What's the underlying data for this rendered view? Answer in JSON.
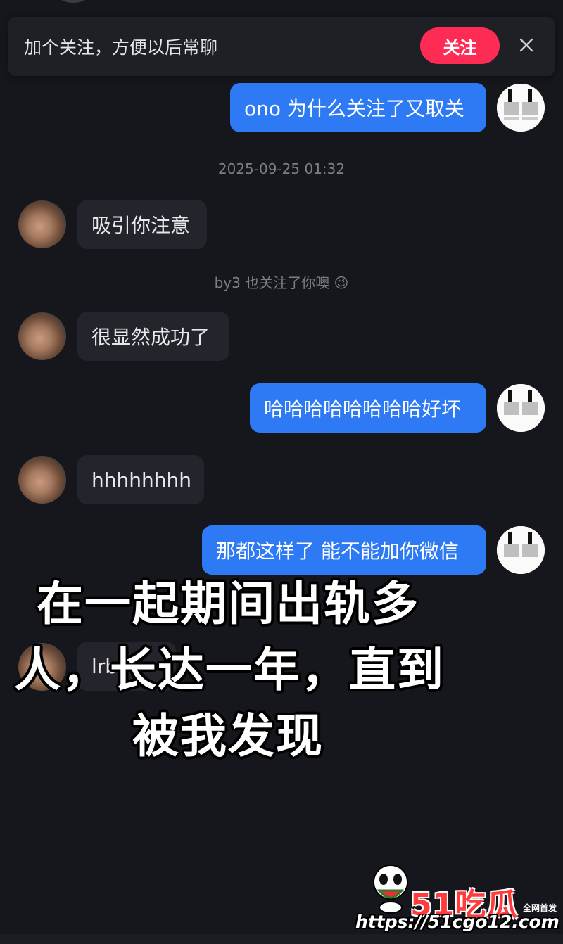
{
  "follow_banner": {
    "text": "加个关注，方便以后常聊",
    "follow_label": "关注"
  },
  "messages": [
    {
      "side": "sent",
      "text": "ono 为什么关注了又取关"
    },
    {
      "side": "received",
      "text": "吸引你注意"
    },
    {
      "side": "received",
      "text": "很显然成功了"
    },
    {
      "side": "sent",
      "text": "哈哈哈哈哈哈哈哈好坏"
    },
    {
      "side": "received",
      "text": "hhhhhhhh"
    },
    {
      "side": "sent",
      "text": "那都这样了 能不能加你微信"
    },
    {
      "side": "received",
      "text": "lrb"
    }
  ],
  "timestamp": "2025-09-25 01:32",
  "system_notice": "by3 也关注了你噢 😉",
  "overlay_caption": {
    "line1": "在一起期间出轨多",
    "line2": "人，长达一年，直到",
    "line3": "被我发现"
  },
  "watermark": {
    "brand": "51吃瓜",
    "tag": "全网首发",
    "url": "https://51cgo12.com"
  },
  "colors": {
    "background": "#16171c",
    "sent_bubble": "#2e7af5",
    "received_bubble": "#24252c",
    "follow_button": "#fe2c55"
  }
}
